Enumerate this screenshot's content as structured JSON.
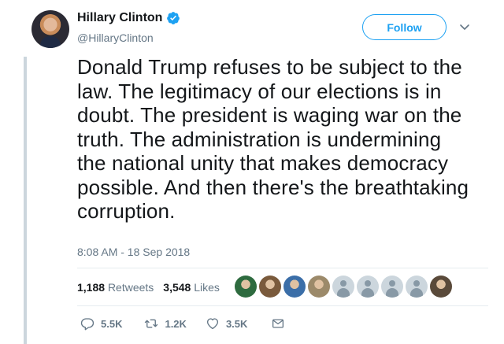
{
  "author": {
    "name": "Hillary Clinton",
    "handle": "@HillaryClinton",
    "verified": true
  },
  "follow_label": "Follow",
  "tweet": {
    "text": "Donald Trump refuses to be subject to the law. The legitimacy of our elections is in doubt. The president is waging war on the truth. The administration is undermining the national unity that makes democracy possible. And then there's the breathtaking corruption.",
    "timestamp": "8:08 AM - 18 Sep 2018"
  },
  "stats": {
    "retweets_count": "1,188",
    "retweets_label": "Retweets",
    "likes_count": "3,548",
    "likes_label": "Likes"
  },
  "likers": [
    {
      "icon": "green-logo-avatar",
      "color": "#2e6b3f"
    },
    {
      "icon": "person-avatar",
      "color": "#7a5a3c"
    },
    {
      "icon": "globe-avatar",
      "color": "#3b6ea8"
    },
    {
      "icon": "person-avatar",
      "color": "#9c8a6a"
    },
    {
      "icon": "default-avatar",
      "color": "#ccd6dd"
    },
    {
      "icon": "default-avatar",
      "color": "#ccd6dd"
    },
    {
      "icon": "default-avatar",
      "color": "#ccd6dd"
    },
    {
      "icon": "default-avatar",
      "color": "#ccd6dd"
    },
    {
      "icon": "person-avatar",
      "color": "#5a4a3a"
    }
  ],
  "actions": {
    "replies": "5.5K",
    "retweets": "1.2K",
    "likes": "3.5K"
  },
  "colors": {
    "accent": "#1da1f2",
    "text": "#14171a",
    "secondary": "#657786",
    "rail": "#ccd6dd"
  }
}
